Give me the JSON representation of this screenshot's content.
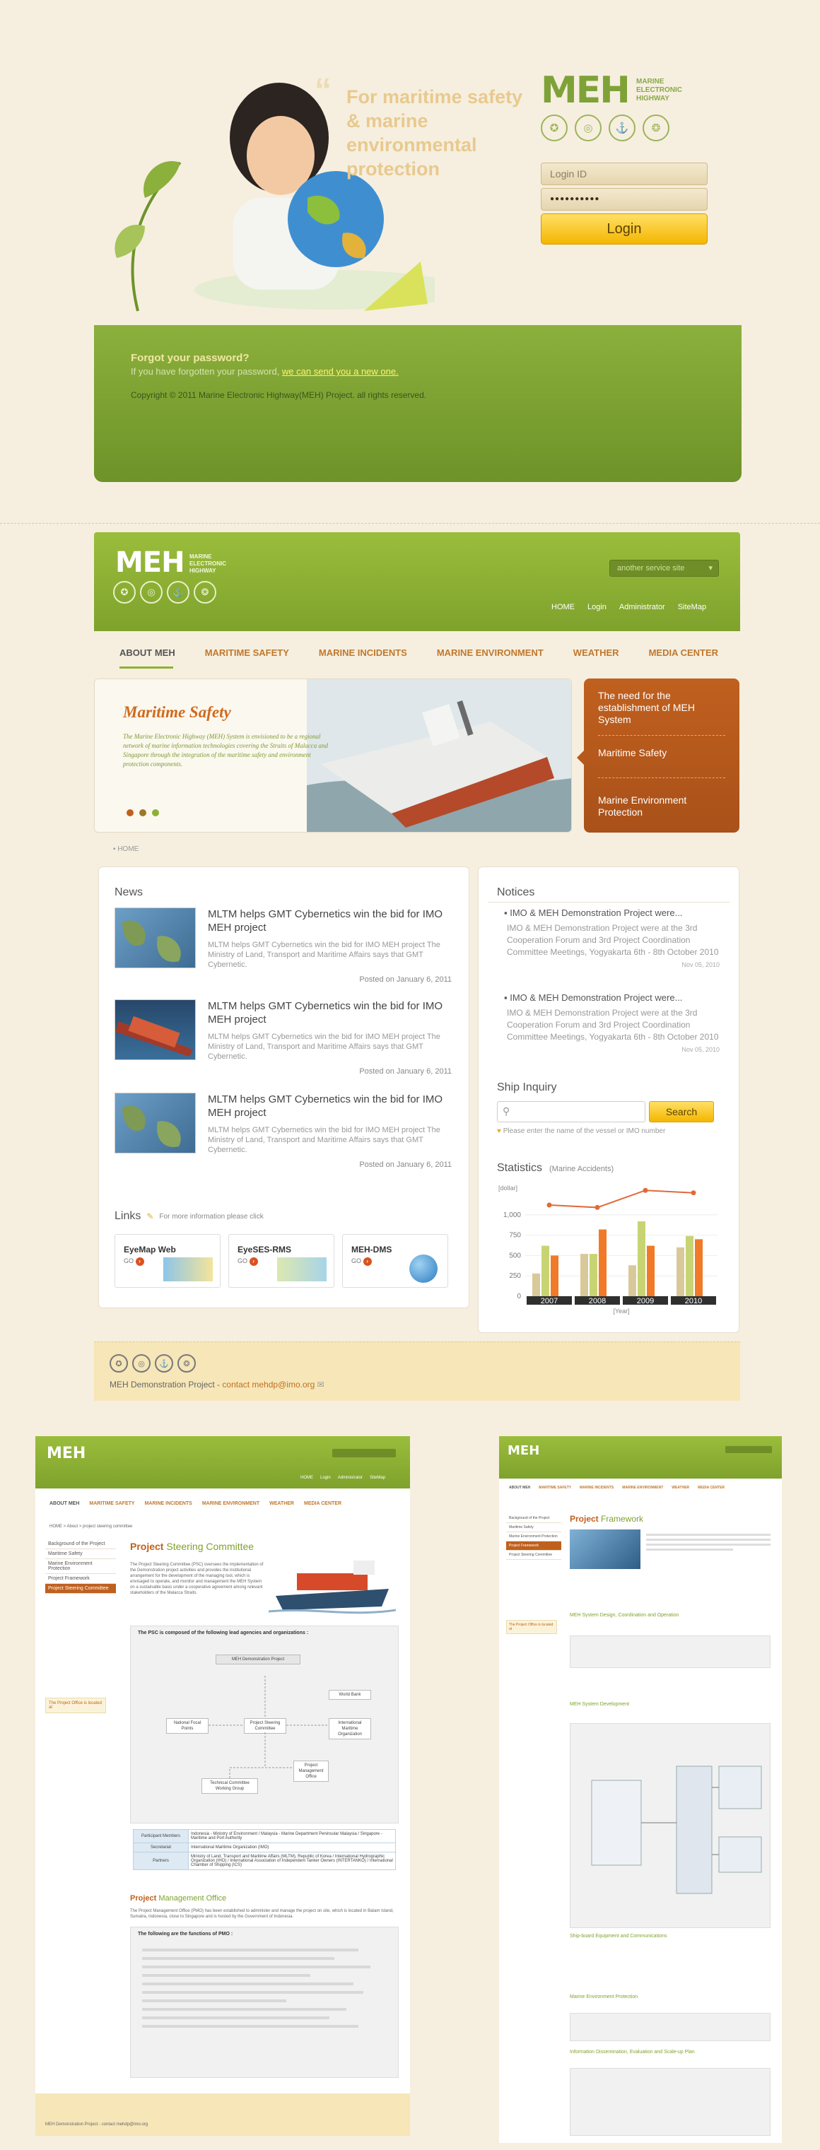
{
  "login_page": {
    "quote": "For maritime safety & marine environmental protection",
    "logo": {
      "text": "MEH",
      "sub": [
        "MARINE",
        "ELECTRONIC",
        "HIGHWAY"
      ]
    },
    "login_id_placeholder": "Login ID",
    "password_mask": "●●●●●●●●●●",
    "login_button": "Login",
    "forgot_title": "Forgot your password?",
    "forgot_desc": "If you have forgotten your password,",
    "forgot_link": "we can send you a new one.",
    "copyright": "Copyright © 2011 Marine Electronic Highway(MEH) Project. all rights reserved."
  },
  "main_page": {
    "logo": {
      "text": "MEH",
      "sub": [
        "MARINE",
        "ELECTRONIC",
        "HIGHWAY"
      ]
    },
    "service_select": "another service site",
    "top_links": [
      "HOME",
      "Login",
      "Administrator",
      "SiteMap"
    ],
    "gnb": [
      "ABOUT MEH",
      "MARITIME SAFETY",
      "MARINE INCIDENTS",
      "MARINE ENVIRONMENT",
      "WEATHER",
      "MEDIA CENTER"
    ],
    "hero": {
      "title": "Maritime Safety",
      "desc": "The Marine Electronic Highway (MEH) System is envisioned to be a regional network of marine information technologies covering the Straits of Malacca and Singapore through the integration of the maritime safety and environment protection components.",
      "side_links": [
        "The need for the establishment of MEH System",
        "Maritime Safety",
        "Marine Environment Protection"
      ]
    },
    "breadcrumb": "HOME",
    "news": {
      "heading": "News",
      "items": [
        {
          "title": "MLTM helps GMT Cybernetics win the bid for IMO MEH project",
          "desc": "MLTM helps GMT Cybernetics win the bid for IMO MEH project The Ministry of Land, Transport and Maritime Affairs says that GMT Cybernetic.",
          "date": "Posted on January 6, 2011"
        },
        {
          "title": "MLTM helps GMT Cybernetics win the bid for IMO MEH project",
          "desc": "MLTM helps GMT Cybernetics win the bid for IMO MEH project The Ministry of Land, Transport and Maritime Affairs says that GMT Cybernetic.",
          "date": "Posted on January 6, 2011"
        },
        {
          "title": "MLTM helps GMT Cybernetics win the bid for IMO MEH project",
          "desc": "MLTM helps GMT Cybernetics win the bid for IMO MEH project The Ministry of Land, Transport and Maritime Affairs says that GMT Cybernetic.",
          "date": "Posted on January 6, 2011"
        }
      ]
    },
    "links": {
      "heading": "Links",
      "note": "For more information please click",
      "items": [
        {
          "name": "EyeMap Web",
          "go": "GO"
        },
        {
          "name": "EyeSES-RMS",
          "go": "GO"
        },
        {
          "name": "MEH-DMS",
          "go": "GO"
        }
      ]
    },
    "notices": {
      "heading": "Notices",
      "items": [
        {
          "title": "IMO & MEH Demonstration Project were...",
          "body": "IMO & MEH Demonstration Project were at the 3rd Cooperation Forum and 3rd Project Coordination Committee Meetings, Yogyakarta 6th - 8th October 2010",
          "date": "Nov 05, 2010"
        },
        {
          "title": "IMO & MEH Demonstration Project were...",
          "body": "IMO & MEH Demonstration Project were at the 3rd Cooperation Forum and 3rd Project Coordination Committee Meetings, Yogyakarta 6th - 8th October 2010",
          "date": "Nov 05, 2010"
        }
      ]
    },
    "ship_inquiry": {
      "heading": "Ship Inquiry",
      "button": "Search",
      "hint": "Please enter the name of the vessel or IMO number"
    },
    "statistics": {
      "heading": "Statistics",
      "subheading": "(Marine Accidents)"
    },
    "footer": {
      "text": "MEH Demonstration Project -",
      "contact": "contact mehdp@imo.org"
    }
  },
  "chart_data": {
    "type": "bar",
    "title": "Statistics",
    "subtitle": "(Marine Accidents)",
    "ylabel": "[dollar]",
    "xlabel": "[Year]",
    "categories": [
      "2007",
      "2008",
      "2009",
      "2010"
    ],
    "ylim": [
      0,
      1250
    ],
    "yticks": [
      "0",
      "250",
      "500",
      "750",
      "1,000"
    ],
    "series": [
      {
        "color": "#d9c99a",
        "values": [
          280,
          520,
          380,
          600
        ]
      },
      {
        "color": "#c8d474",
        "values": [
          620,
          520,
          920,
          740
        ]
      },
      {
        "color": "#f07a28",
        "values": [
          500,
          820,
          620,
          700
        ]
      }
    ],
    "line": {
      "color": "#e06a3a",
      "values": [
        1120,
        1090,
        1300,
        1270
      ]
    }
  },
  "sub_page_a": {
    "logo": "MEH",
    "top_links": [
      "HOME",
      "Login",
      "Administrator",
      "SiteMap"
    ],
    "gnb": [
      "ABOUT MEH",
      "MARITIME SAFETY",
      "MARINE INCIDENTS",
      "MARINE ENVIRONMENT",
      "WEATHER",
      "MEDIA CENTER"
    ],
    "breadcrumb": "HOME > About > project steering committee",
    "lnb": [
      "Background of the Project",
      "Maritime Safety",
      "Marine Environment Protection",
      "Project Framework",
      "Project Steering Committee"
    ],
    "title_a": "Project",
    "title_b": "Steering Committee",
    "intro": "The Project Steering Committee (PSC) oversees the implementation of the Demonstration project activities and provides the institutional arrangement for the development of the managing tool, which is envisaged to operate, and monitor and management the MEH System on a sustainable basis under a cooperative agreement among relevant stakeholders of the Malacca Straits.",
    "psc_heading": "The PSC is composed of the following lead agencies and organizations :",
    "org": [
      "MEH Demonstration Project",
      "World Bank",
      "National Focal Points",
      "Project Steering Committee",
      "International Maritime Organization",
      "Project Management Office",
      "Technical Committee Working Group"
    ],
    "table": [
      {
        "k": "Participant Members",
        "v": "Indonesia - Ministry of Environment / Malaysia - Marine Department Peninsular Malaysia / Singapore - Maritime and Port Authority"
      },
      {
        "k": "Secretariat",
        "v": "International Maritime Organization (IMO)"
      },
      {
        "k": "Partners",
        "v": "Ministry of Land, Transport and Maritime Affairs (MLTM), Republic of Korea / International Hydrographic Organization (IHO) / International Association of Independent Tanker Owners (INTERTANKO) / International Chamber of Shipping (ICS)"
      }
    ],
    "pmo_title_a": "Project",
    "pmo_title_b": "Management Office",
    "pmo_text": "The Project Management Office (PMO) has been established to administer and manage the project on site, which is located in Batam Island, Sumatra, Indonesia, close to Singapore and is hosted by the Government of Indonesia.",
    "pmo_heading": "The following are the functions of PMO :",
    "side_note": "The Project Office is located at",
    "footer": "MEH Demonstration Project - contact mehdp@imo.org"
  },
  "sub_page_b": {
    "logo": "MEH",
    "title_a": "Project",
    "title_b": "Framework",
    "lnb": [
      "Background of the Project",
      "Maritime Safety",
      "Marine Environment Protection",
      "Project Framework",
      "Project Steering Committee"
    ],
    "components": [
      "MEH System Design, Coordination and Operation",
      "MEH System Development",
      "Ship-board Equipment and Communications",
      "Marine Environment Protection",
      "Information Dissemination, Evaluation and Scale-up Plan"
    ],
    "side_note": "The Project Office is located at"
  }
}
